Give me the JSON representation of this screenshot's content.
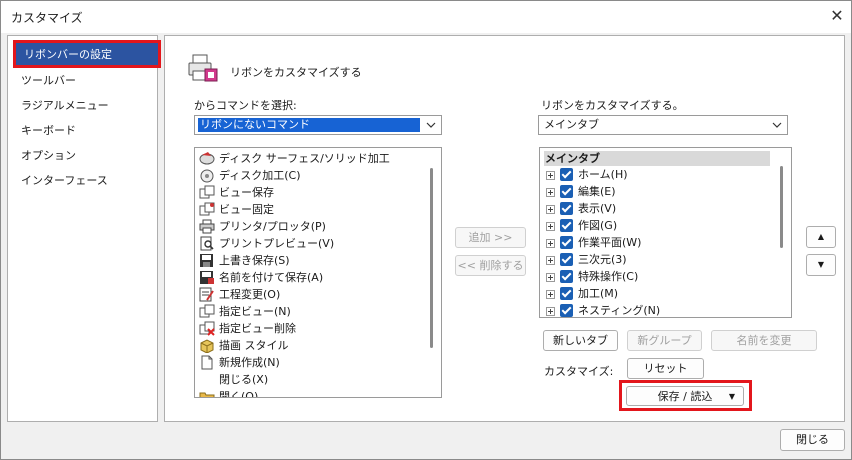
{
  "window": {
    "title": "カスタマイズ",
    "close_glyph": "✕"
  },
  "sidebar": {
    "items": [
      {
        "label": "リボンバーの設定",
        "selected": true
      },
      {
        "label": "ツールバー"
      },
      {
        "label": "ラジアルメニュー"
      },
      {
        "label": "キーボード"
      },
      {
        "label": "オプション"
      },
      {
        "label": "インターフェース"
      }
    ]
  },
  "panel": {
    "heading": "リボンをカスタマイズする",
    "left_combo_label": "からコマンドを選択:",
    "left_combo_value": "リボンにないコマンド",
    "right_combo_label": "リボンをカスタマイズする。",
    "right_combo_value": "メインタブ",
    "commands": [
      {
        "label": "ディスク サーフェス/ソリッド加工",
        "icon": "disk-surface-icon"
      },
      {
        "label": "ディスク加工(C)",
        "icon": "disk-icon"
      },
      {
        "label": "ビュー保存",
        "icon": "view-save-icon"
      },
      {
        "label": "ビュー固定",
        "icon": "view-pin-icon"
      },
      {
        "label": "プリンタ/プロッタ(P)",
        "icon": "printer-icon"
      },
      {
        "label": "プリントプレビュー(V)",
        "icon": "print-preview-icon"
      },
      {
        "label": "上書き保存(S)",
        "icon": "save-icon"
      },
      {
        "label": "名前を付けて保存(A)",
        "icon": "save-as-icon"
      },
      {
        "label": "工程変更(O)",
        "icon": "process-change-icon"
      },
      {
        "label": "指定ビュー(N)",
        "icon": "named-view-icon"
      },
      {
        "label": "指定ビュー削除",
        "icon": "delete-view-icon"
      },
      {
        "label": "描画 スタイル",
        "icon": "render-style-icon"
      },
      {
        "label": "新規作成(N)",
        "icon": "new-file-icon"
      },
      {
        "label": "閉じる(X)",
        "icon": ""
      },
      {
        "label": "開く(O)",
        "icon": "open-folder-icon"
      }
    ],
    "add_button": "追加 >>",
    "remove_button": "<< 削除する",
    "tree_header": "メインタブ",
    "tabs": [
      "ホーム(H)",
      "編集(E)",
      "表示(V)",
      "作図(G)",
      "作業平面(W)",
      "三次元(3)",
      "特殊操作(C)",
      "加工(M)",
      "ネスティング(N)"
    ],
    "move_up_glyph": "▲",
    "move_down_glyph": "▼",
    "new_tab_button": "新しいタブ",
    "new_group_button": "新グループ",
    "rename_button": "名前を変更",
    "customize_label": "カスタマイズ:",
    "reset_button": "リセット",
    "save_load_button": "保存 / 読込",
    "save_load_arrow": "▼"
  },
  "footer": {
    "close_button": "閉じる"
  },
  "colors": {
    "selection": "#2c54a1",
    "highlight_box": "#e3161c",
    "checkbox": "#1a5fb4"
  }
}
